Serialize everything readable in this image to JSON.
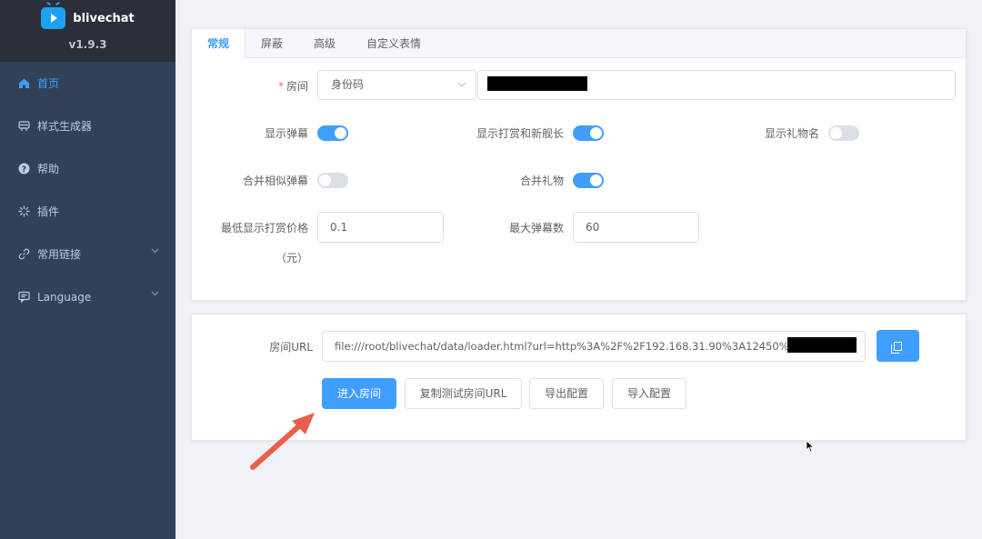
{
  "brand": {
    "name": "blivechat",
    "version": "v1.9.3"
  },
  "sidebar": {
    "items": [
      {
        "label": "首页",
        "icon": "home-icon"
      },
      {
        "label": "样式生成器",
        "icon": "palette-icon"
      },
      {
        "label": "帮助",
        "icon": "help-icon"
      },
      {
        "label": "插件",
        "icon": "plugin-icon"
      },
      {
        "label": "常用链接",
        "icon": "link-icon"
      },
      {
        "label": "Language",
        "icon": "language-icon"
      }
    ]
  },
  "tabs": [
    "常规",
    "屏蔽",
    "高级",
    "自定义表情"
  ],
  "form": {
    "room_label": "房间",
    "room_type": "身份码",
    "show_danmaku_label": "显示弹幕",
    "show_danmaku": true,
    "show_gift_label": "显示打赏和新舰长",
    "show_gift": true,
    "show_gift_name_label": "显示礼物名",
    "show_gift_name": false,
    "merge_similar_label": "合并相似弹幕",
    "merge_similar": false,
    "merge_gift_label": "合并礼物",
    "merge_gift": true,
    "min_price_label_1": "最低显示打赏价格",
    "min_price_label_2": "（元）",
    "min_price": "0.1",
    "max_danmaku_label": "最大弹幕数",
    "max_danmaku": "60"
  },
  "url_section": {
    "label": "房间URL",
    "value": "file:///root/blivechat/data/loader.html?url=http%3A%2F%2F192.168.31.90%3A12450%2Froom%",
    "buttons": {
      "enter": "进入房间",
      "copy_test": "复制测试房间URL",
      "export": "导出配置",
      "import": "导入配置"
    }
  },
  "colors": {
    "sidebar_bg": "#324157",
    "brand_bg": "#2b2f3a",
    "accent": "#409eff",
    "annotation_arrow": "#e8604c"
  }
}
